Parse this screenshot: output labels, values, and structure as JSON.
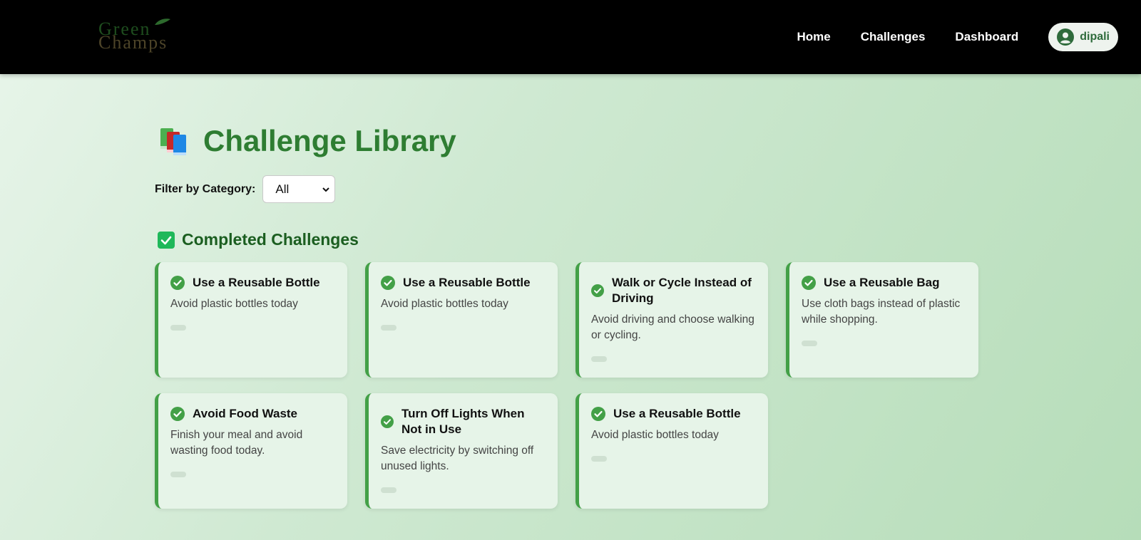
{
  "brand": {
    "line1": "Green",
    "line2": "Champs"
  },
  "nav": {
    "links": [
      "Home",
      "Challenges",
      "Dashboard"
    ],
    "user": {
      "name": "dipali",
      "icon": "user-circle-icon"
    }
  },
  "page": {
    "title": "Challenge Library",
    "title_icon": "books-icon",
    "filter": {
      "label": "Filter by Category:",
      "selected": "All"
    },
    "section": {
      "title": "Completed Challenges",
      "icon": "checkbox-checked-icon"
    }
  },
  "cards": [
    {
      "title": "Use a Reusable Bottle",
      "desc": "Avoid plastic bottles today"
    },
    {
      "title": "Use a Reusable Bottle",
      "desc": "Avoid plastic bottles today"
    },
    {
      "title": "Walk or Cycle Instead of Driving",
      "desc": "Avoid driving and choose walking or cycling."
    },
    {
      "title": "Use a Reusable Bag",
      "desc": "Use cloth bags instead of plastic while shopping."
    },
    {
      "title": "Avoid Food Waste",
      "desc": "Finish your meal and avoid wasting food today."
    },
    {
      "title": "Turn Off Lights When Not in Use",
      "desc": "Save electricity by switching off unused lights."
    },
    {
      "title": "Use a Reusable Bottle",
      "desc": "Avoid plastic bottles today"
    }
  ],
  "colors": {
    "accent": "#2e7d32",
    "card_bg": "#e6f4e8",
    "card_border": "#43a047",
    "header_bg": "#000000"
  }
}
